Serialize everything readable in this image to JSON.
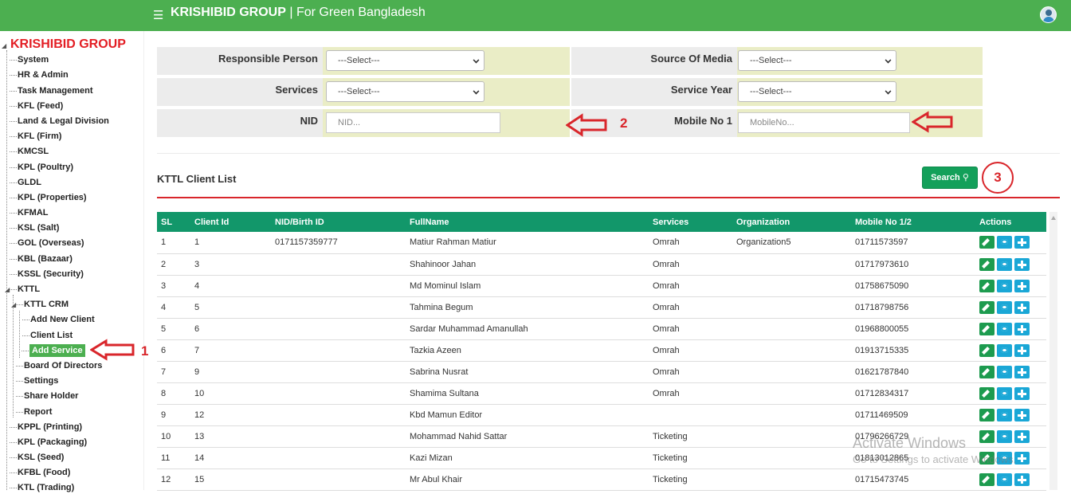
{
  "header": {
    "brand": "KRISHIBID GROUP",
    "tagline": " | For Green Bangladesh"
  },
  "sidebar": {
    "root": "KRISHIBID GROUP",
    "items": [
      {
        "label": "System"
      },
      {
        "label": "HR & Admin"
      },
      {
        "label": "Task Management"
      },
      {
        "label": "KFL (Feed)"
      },
      {
        "label": "Land & Legal Division"
      },
      {
        "label": "KFL (Firm)"
      },
      {
        "label": "KMCSL"
      },
      {
        "label": "KPL (Poultry)"
      },
      {
        "label": "GLDL"
      },
      {
        "label": "KPL (Properties)"
      },
      {
        "label": "KFMAL"
      },
      {
        "label": "KSL (Salt)"
      },
      {
        "label": "GOL (Overseas)"
      },
      {
        "label": "KBL (Bazaar)"
      },
      {
        "label": "KSSL (Security)"
      },
      {
        "label": "KTTL"
      },
      {
        "label": "KTTL CRM"
      },
      {
        "label": "Add New Client"
      },
      {
        "label": "Client List"
      },
      {
        "label": "Add Service"
      },
      {
        "label": "Board Of Directors"
      },
      {
        "label": "Settings"
      },
      {
        "label": "Share Holder"
      },
      {
        "label": "Report"
      },
      {
        "label": "KPPL (Printing)"
      },
      {
        "label": "KPL (Packaging)"
      },
      {
        "label": "KSL (Seed)"
      },
      {
        "label": "KFBL (Food)"
      },
      {
        "label": "KTL (Trading)"
      }
    ]
  },
  "filters": {
    "responsible_person": {
      "label": "Responsible Person",
      "value": "---Select---"
    },
    "source_of_media": {
      "label": "Source Of Media",
      "value": "---Select---"
    },
    "services": {
      "label": "Services",
      "value": "---Select---"
    },
    "service_year": {
      "label": "Service Year",
      "value": "---Select---"
    },
    "nid": {
      "label": "NID",
      "placeholder": "NID..."
    },
    "mobile": {
      "label": "Mobile No 1",
      "placeholder": "MobileNo..."
    }
  },
  "list": {
    "title": "KTTL Client List",
    "search_label": "Search"
  },
  "annotations": {
    "a1": "1",
    "a2": "2",
    "a3": "3"
  },
  "table": {
    "columns": [
      "SL",
      "Client Id",
      "NID/Birth ID",
      "FullName",
      "Services",
      "Organization",
      "Mobile No 1/2",
      "Actions"
    ],
    "rows": [
      [
        "1",
        "1",
        "0171157359777",
        "Matiur Rahman Matiur",
        "Omrah",
        "Organization5",
        "01711573597"
      ],
      [
        "2",
        "3",
        "",
        "Shahinoor Jahan",
        "Omrah",
        "",
        "01717973610"
      ],
      [
        "3",
        "4",
        "",
        "Md Mominul Islam",
        "Omrah",
        "",
        "01758675090"
      ],
      [
        "4",
        "5",
        "",
        "Tahmina Begum",
        "Omrah",
        "",
        "01718798756"
      ],
      [
        "5",
        "6",
        "",
        "Sardar Muhammad Amanullah",
        "Omrah",
        "",
        "01968800055"
      ],
      [
        "6",
        "7",
        "",
        "Tazkia Azeen",
        "Omrah",
        "",
        "01913715335"
      ],
      [
        "7",
        "9",
        "",
        "Sabrina Nusrat",
        "Omrah",
        "",
        "01621787840"
      ],
      [
        "8",
        "10",
        "",
        "Shamima Sultana",
        "Omrah",
        "",
        "01712834317"
      ],
      [
        "9",
        "12",
        "",
        "Kbd Mamun Editor",
        "",
        "",
        "01711469509"
      ],
      [
        "10",
        "13",
        "",
        "Mohammad Nahid Sattar",
        "Ticketing",
        "",
        "01796266729"
      ],
      [
        "11",
        "14",
        "",
        "Kazi Mizan",
        "Ticketing",
        "",
        "01813012865"
      ],
      [
        "12",
        "15",
        "",
        "Mr Abul Khair",
        "Ticketing",
        "",
        "01715473745"
      ]
    ]
  },
  "watermark": {
    "line1": "Activate Windows",
    "line2": "Go to Settings to activate Windows."
  }
}
